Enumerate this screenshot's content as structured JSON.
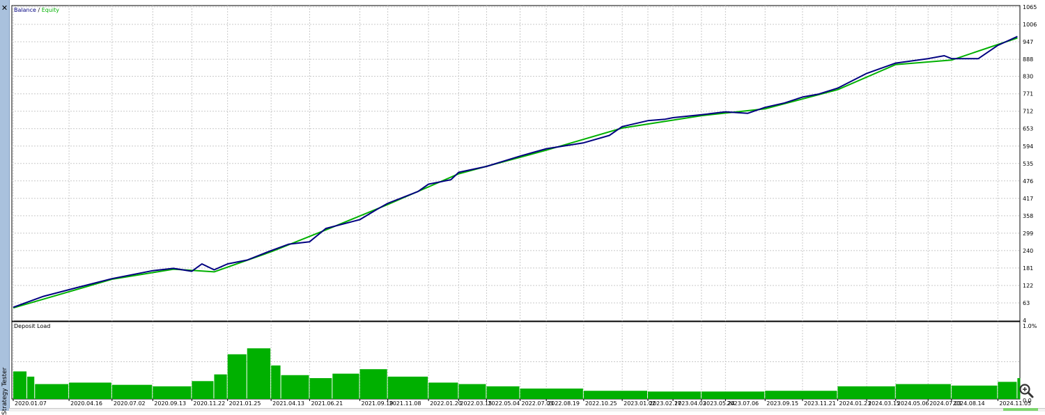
{
  "side_panel": {
    "label": "Strategy Tester",
    "close_glyph": "✕"
  },
  "chart_data": [
    {
      "type": "line",
      "title": "",
      "legend": {
        "balance": "Balance",
        "separator": "/",
        "equity": "Equity"
      },
      "series": [
        {
          "name": "Balance",
          "color": "#000080",
          "x": [
            "2020.01.07",
            "2020.03.01",
            "2020.05.01",
            "2020.07.02",
            "2020.09.13",
            "2020.10.20",
            "2020.11.22",
            "2020.12.10",
            "2021.01.01",
            "2021.01.25",
            "2021.03.01",
            "2021.04.13",
            "2021.05.15",
            "2021.06.21",
            "2021.07.20",
            "2021.09.19",
            "2021.10.20",
            "2021.11.08",
            "2022.01.01",
            "2022.01.20",
            "2022.03.01",
            "2022.03.15",
            "2022.05.04",
            "2022.07.03",
            "2022.08.19",
            "2022.10.25",
            "2022.12.10",
            "2023.01.02",
            "2023.02.17",
            "2023.03.20",
            "2023.04.03",
            "2023.05.24",
            "2023.07.06",
            "2023.08.15",
            "2023.09.15",
            "2023.10.20",
            "2023.11.21",
            "2023.12.20",
            "2024.01.23",
            "2024.03.15",
            "2024.05.06",
            "2024.07.03",
            "2024.08.01",
            "2024.08.14",
            "2024.10.01",
            "2024.11.05",
            "2024.12.10"
          ],
          "y": [
            48,
            85,
            115,
            145,
            172,
            180,
            170,
            195,
            175,
            195,
            208,
            240,
            262,
            270,
            315,
            345,
            380,
            400,
            440,
            465,
            480,
            505,
            525,
            560,
            585,
            605,
            630,
            660,
            680,
            685,
            690,
            700,
            710,
            705,
            725,
            740,
            760,
            770,
            790,
            840,
            875,
            890,
            900,
            890,
            890,
            935,
            965
          ]
        },
        {
          "name": "Equity",
          "color": "#00b000",
          "x": [
            "2020.01.07",
            "2020.07.02",
            "2020.10.20",
            "2021.01.01",
            "2021.04.13",
            "2021.07.20",
            "2021.11.08",
            "2022.03.15",
            "2022.08.19",
            "2023.01.02",
            "2023.05.24",
            "2023.09.15",
            "2024.01.23",
            "2024.05.06",
            "2024.08.14",
            "2024.12.10"
          ],
          "y": [
            46,
            143,
            177,
            168,
            236,
            310,
            396,
            500,
            580,
            655,
            697,
            720,
            785,
            870,
            885,
            960
          ]
        }
      ],
      "ylim": [
        4,
        1065
      ],
      "y_ticks": [
        "1065",
        "1006",
        "947",
        "888",
        "830",
        "771",
        "712",
        "653",
        "594",
        "535",
        "476",
        "417",
        "358",
        "299",
        "240",
        "181",
        "122",
        "63",
        "4"
      ],
      "x_ticks": [
        "2020.01.07",
        "2020.04.16",
        "2020.07.02",
        "2020.09.13",
        "2020.11.22",
        "2021.01.25",
        "2021.04.13",
        "2021.06.21",
        "2021.09.19",
        "2021.11.08",
        "2022.01.20",
        "2022.03.15",
        "2022.05.04",
        "2022.07.03",
        "2022.08.19",
        "2022.10.25",
        "2023.01.02",
        "2023.02.17",
        "2023.04.03",
        "2023.05.24",
        "2023.07.06",
        "2023.09.15",
        "2023.11.21",
        "2024.01.23",
        "2024.03.15",
        "2024.05.06",
        "2024.07.03",
        "2024.08.14",
        "2024.11.05"
      ],
      "grid": true,
      "background": "#ffffff",
      "grid_color": "#c8c8c8"
    },
    {
      "type": "bar",
      "title": "Deposit Load",
      "color": "#00b000",
      "ylim": [
        0,
        1.0
      ],
      "y_ticks": [
        "1.0%",
        "0.0"
      ],
      "series": [
        {
          "name": "Deposit Load",
          "x": [
            "2020.01.07",
            "2020.02.01",
            "2020.02.15",
            "2020.04.16",
            "2020.07.02",
            "2020.09.13",
            "2020.11.22",
            "2021.01.01",
            "2021.01.25",
            "2021.03.01",
            "2021.04.13",
            "2021.05.01",
            "2021.06.21",
            "2021.08.01",
            "2021.09.19",
            "2021.11.08",
            "2022.01.20",
            "2022.03.15",
            "2022.05.04",
            "2022.07.03",
            "2022.10.25",
            "2023.02.17",
            "2023.05.24",
            "2023.09.15",
            "2024.01.23",
            "2024.05.06",
            "2024.08.14",
            "2024.11.05",
            "2024.12.10"
          ],
          "y": [
            0.37,
            0.3,
            0.2,
            0.22,
            0.19,
            0.17,
            0.24,
            0.33,
            0.6,
            0.68,
            0.45,
            0.32,
            0.28,
            0.34,
            0.4,
            0.3,
            0.22,
            0.2,
            0.17,
            0.14,
            0.11,
            0.1,
            0.1,
            0.11,
            0.17,
            0.2,
            0.18,
            0.23,
            0.28
          ]
        }
      ]
    }
  ]
}
